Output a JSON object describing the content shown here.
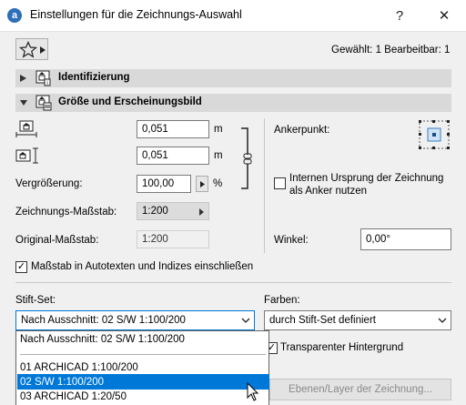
{
  "window": {
    "title": "Einstellungen für die Zeichnungs-Auswahl",
    "help_label": "?",
    "close_label": "✕"
  },
  "header": {
    "selection_info": "Gewählt: 1 Bearbeitbar: 1"
  },
  "sections": {
    "identification": "Identifizierung",
    "size_appearance": "Größe und Erscheinungsbild"
  },
  "size": {
    "width_value": "0,051",
    "width_unit": "m",
    "height_value": "0,051",
    "height_unit": "m",
    "magnification_label": "Vergrößerung:",
    "magnification_value": "100,00",
    "magnification_unit": "%",
    "drawing_scale_label": "Zeichnungs-Maßstab:",
    "drawing_scale_value": "1:200",
    "original_scale_label": "Original-Maßstab:",
    "original_scale_value": "1:200"
  },
  "anchor": {
    "label": "Ankerpunkt:",
    "use_origin_label_line1": "Internen Ursprung der Zeichnung",
    "use_origin_label_line2": "als Anker nutzen",
    "use_origin_checked": false,
    "angle_label": "Winkel:",
    "angle_value": "0,00°"
  },
  "scale_in_autotext": {
    "label": "Maßstab in Autotexten und Indizes einschließen",
    "checked": true
  },
  "pens": {
    "pen_set_label": "Stift-Set:",
    "pen_set_value": "Nach Ausschnitt: 02 S/W 1:100/200",
    "colors_label": "Farben:",
    "colors_value": "durch Stift-Set definiert",
    "transparent_label": "Transparenter Hintergrund",
    "transparent_checked": true,
    "layers_button": "Ebenen/Layer der Zeichnung..."
  },
  "dropdown": {
    "options": [
      "Nach Ausschnitt: 02 S/W 1:100/200",
      "01 ARCHICAD 1:100/200",
      "02 S/W 1:100/200",
      "03 ARCHICAD 1:20/50"
    ],
    "selected_index": 2
  },
  "icons": {
    "app": "archicad-icon",
    "favorites": "star-icon",
    "identification": "id-info-icon",
    "size": "size-appearance-icon"
  },
  "colors": {
    "accent": "#0078d7",
    "section_bg": "#d9d9d9",
    "dialog_bg": "#f0f0f0"
  }
}
